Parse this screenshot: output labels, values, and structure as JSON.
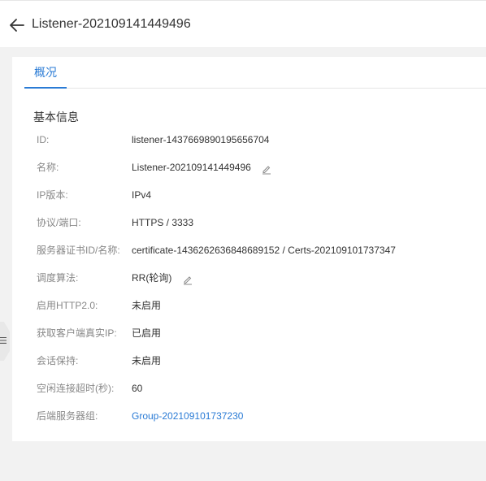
{
  "header": {
    "title": "Listener-202109141449496"
  },
  "tabs": [
    {
      "label": "概况"
    }
  ],
  "section": {
    "title": "基本信息"
  },
  "fields": [
    {
      "label": "ID:",
      "value": "listener-1437669890195656704"
    },
    {
      "label": "名称:",
      "value": "Listener-202109141449496"
    },
    {
      "label": "IP版本:",
      "value": "IPv4"
    },
    {
      "label": "协议/端口:",
      "value": "HTTPS / 3333"
    },
    {
      "label": "服务器证书ID/名称:",
      "value": "certificate-1436262636848689152 / Certs-202109101737347"
    },
    {
      "label": "调度算法:",
      "value": "RR(轮询)"
    },
    {
      "label": "启用HTTP2.0:",
      "value": "未启用"
    },
    {
      "label": "获取客户端真实IP:",
      "value": "已启用"
    },
    {
      "label": "会话保持:",
      "value": "未启用"
    },
    {
      "label": "空闲连接超时(秒):",
      "value": "60"
    },
    {
      "label": "后端服务器组:",
      "value": "Group-202109101737230"
    }
  ],
  "side_handle": {
    "icon": "menu-lines-icon",
    "glyph": "☰"
  },
  "colors": {
    "accent": "#2a7bd5",
    "label": "#888888",
    "text": "#333333",
    "background": "#f2f2f2"
  }
}
